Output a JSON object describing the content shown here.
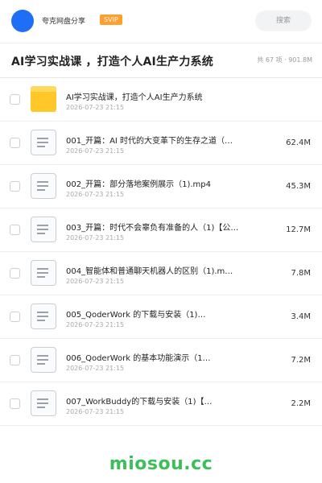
{
  "header": {
    "app_name": "夸克网盘分享",
    "badge": "SVIP",
    "search_placeholder": "搜索"
  },
  "folder": {
    "title": "AI学习实战课 ，打造个人AI生产力系统",
    "summary": "共 67 项 · 901.8M"
  },
  "files": [
    {
      "name": "AI学习实战课，打造个人AI生产力系统",
      "date": "2026-07-23 21:15",
      "size": "",
      "type": "folder"
    },
    {
      "name": "001_开篇：AI 时代的大变革下的生存之道（…",
      "date": "2026-07-23 21:15",
      "size": "62.4M",
      "type": "file"
    },
    {
      "name": "002_开篇：部分落地案例展示（1).mp4",
      "date": "2026-07-23 21:15",
      "size": "45.3M",
      "type": "file"
    },
    {
      "name": "003_开篇：时代不会辜负有准备的人（1)【公…",
      "date": "2026-07-23 21:15",
      "size": "12.7M",
      "type": "file"
    },
    {
      "name": "004_智能体和普通聊天机器人的区别（1).m…",
      "date": "2026-07-23 21:15",
      "size": "7.8M",
      "type": "file"
    },
    {
      "name": "005_QoderWork 的下载与安装（1)…",
      "date": "2026-07-23 21:15",
      "size": "3.4M",
      "type": "file"
    },
    {
      "name": "006_QoderWork 的基本功能演示（1…",
      "date": "2026-07-23 21:15",
      "size": "7.2M",
      "type": "file"
    },
    {
      "name": "007_WorkBuddy的下载与安装（1)【…",
      "date": "2026-07-23 21:15",
      "size": "2.2M",
      "type": "file"
    }
  ],
  "watermark": "miosou.cc",
  "colors": {
    "brand": "#1e6ff5",
    "svip": "#ff9f2e",
    "folder": "#ffc727",
    "watermark": "#3cbf5a"
  }
}
